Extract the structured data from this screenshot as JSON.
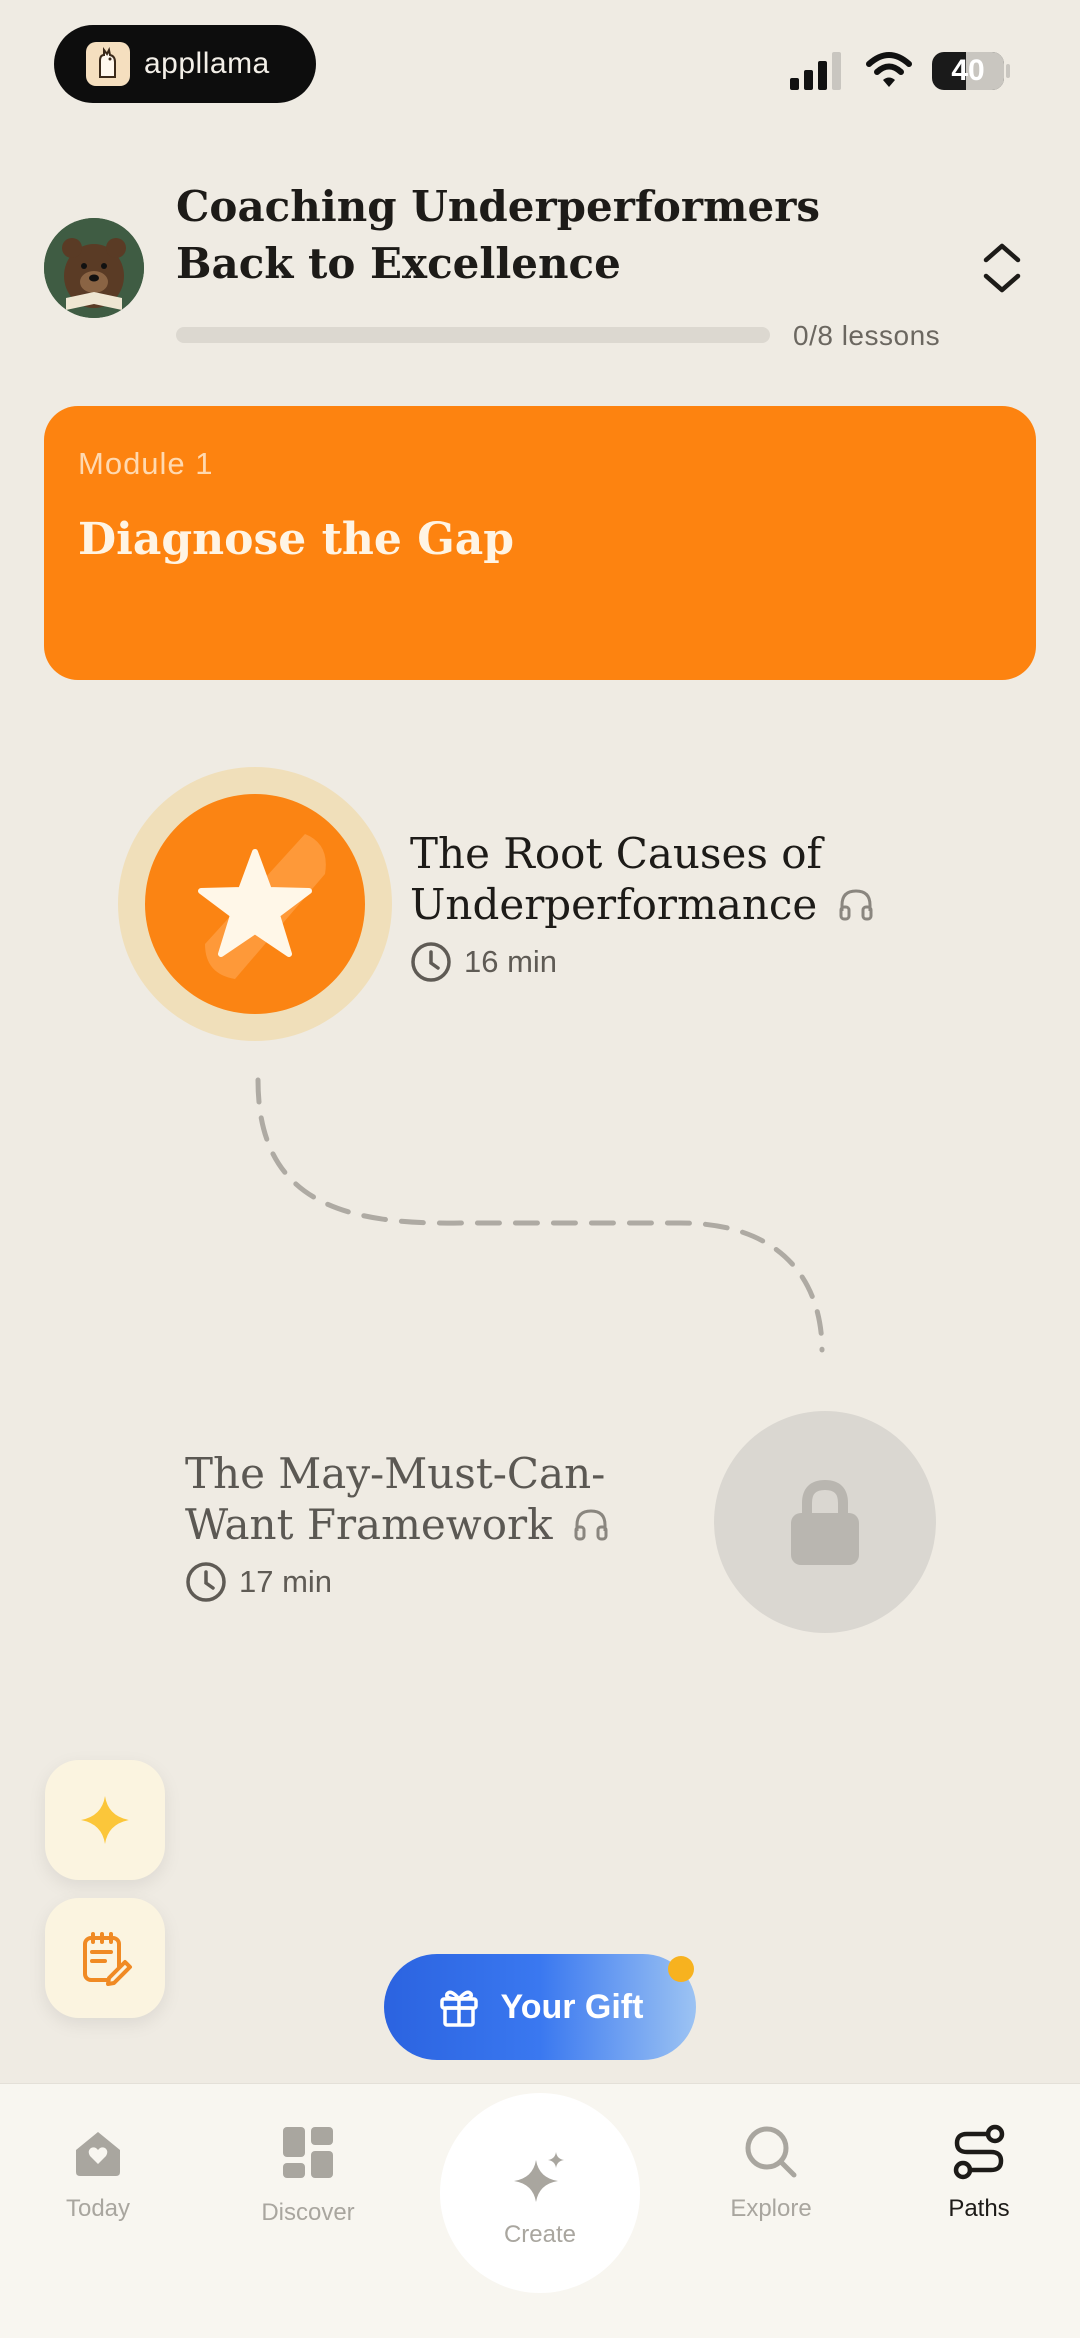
{
  "status_bar": {
    "app_name": "appllama",
    "battery_level": "40"
  },
  "course": {
    "title": "Coaching Underperformers Back to Excellence",
    "progress_text": "0/8 lessons",
    "progress_fraction": 0
  },
  "module": {
    "label": "Module 1",
    "title": "Diagnose the Gap"
  },
  "lessons": [
    {
      "title": "The Root Causes of Underperformance",
      "duration": "16 min",
      "state": "current",
      "audio": true
    },
    {
      "title": "The May-Must-Can-Want Framework",
      "duration": "17 min",
      "state": "locked",
      "audio": true
    }
  ],
  "gift_button": {
    "label": "Your Gift"
  },
  "tabs": [
    {
      "label": "Today",
      "icon": "home-heart-icon"
    },
    {
      "label": "Discover",
      "icon": "grid-icon"
    },
    {
      "label": "Create",
      "icon": "sparkle-icon"
    },
    {
      "label": "Explore",
      "icon": "search-icon"
    },
    {
      "label": "Paths",
      "icon": "paths-icon",
      "active": true
    }
  ],
  "colors": {
    "background": "#efebe3",
    "accent_orange": "#fd8310",
    "gift_blue": "#2b63e0",
    "active_tab": "#1d1b18",
    "inactive_tab": "#a9a69f"
  }
}
